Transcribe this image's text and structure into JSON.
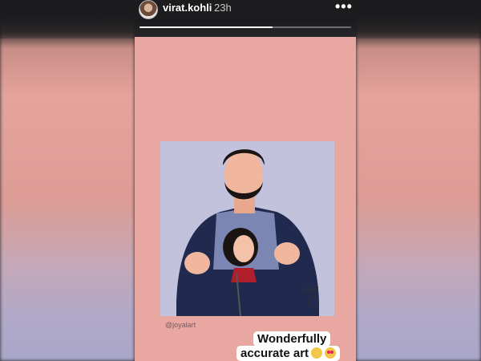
{
  "story": {
    "username": "virat.kohli",
    "timestamp": "23h",
    "more_icon": "more-horizontal-icon",
    "progress": 0.63
  },
  "artwork": {
    "watermark": "@joyalart",
    "signature": "joyal",
    "colors": {
      "background": "#c3c2dd",
      "jacket": "#1f2a4e",
      "shirt": "#7b86b2",
      "skin": "#f0b79e",
      "hair": "#1a1412"
    }
  },
  "caption": {
    "line1": "Wonderfully",
    "line2": "accurate art",
    "emojis": [
      "ok-hand-emoji",
      "heart-eyes-emoji"
    ]
  },
  "colors": {
    "story_background": "#e8a7a0",
    "header": "#1c1c1e"
  }
}
